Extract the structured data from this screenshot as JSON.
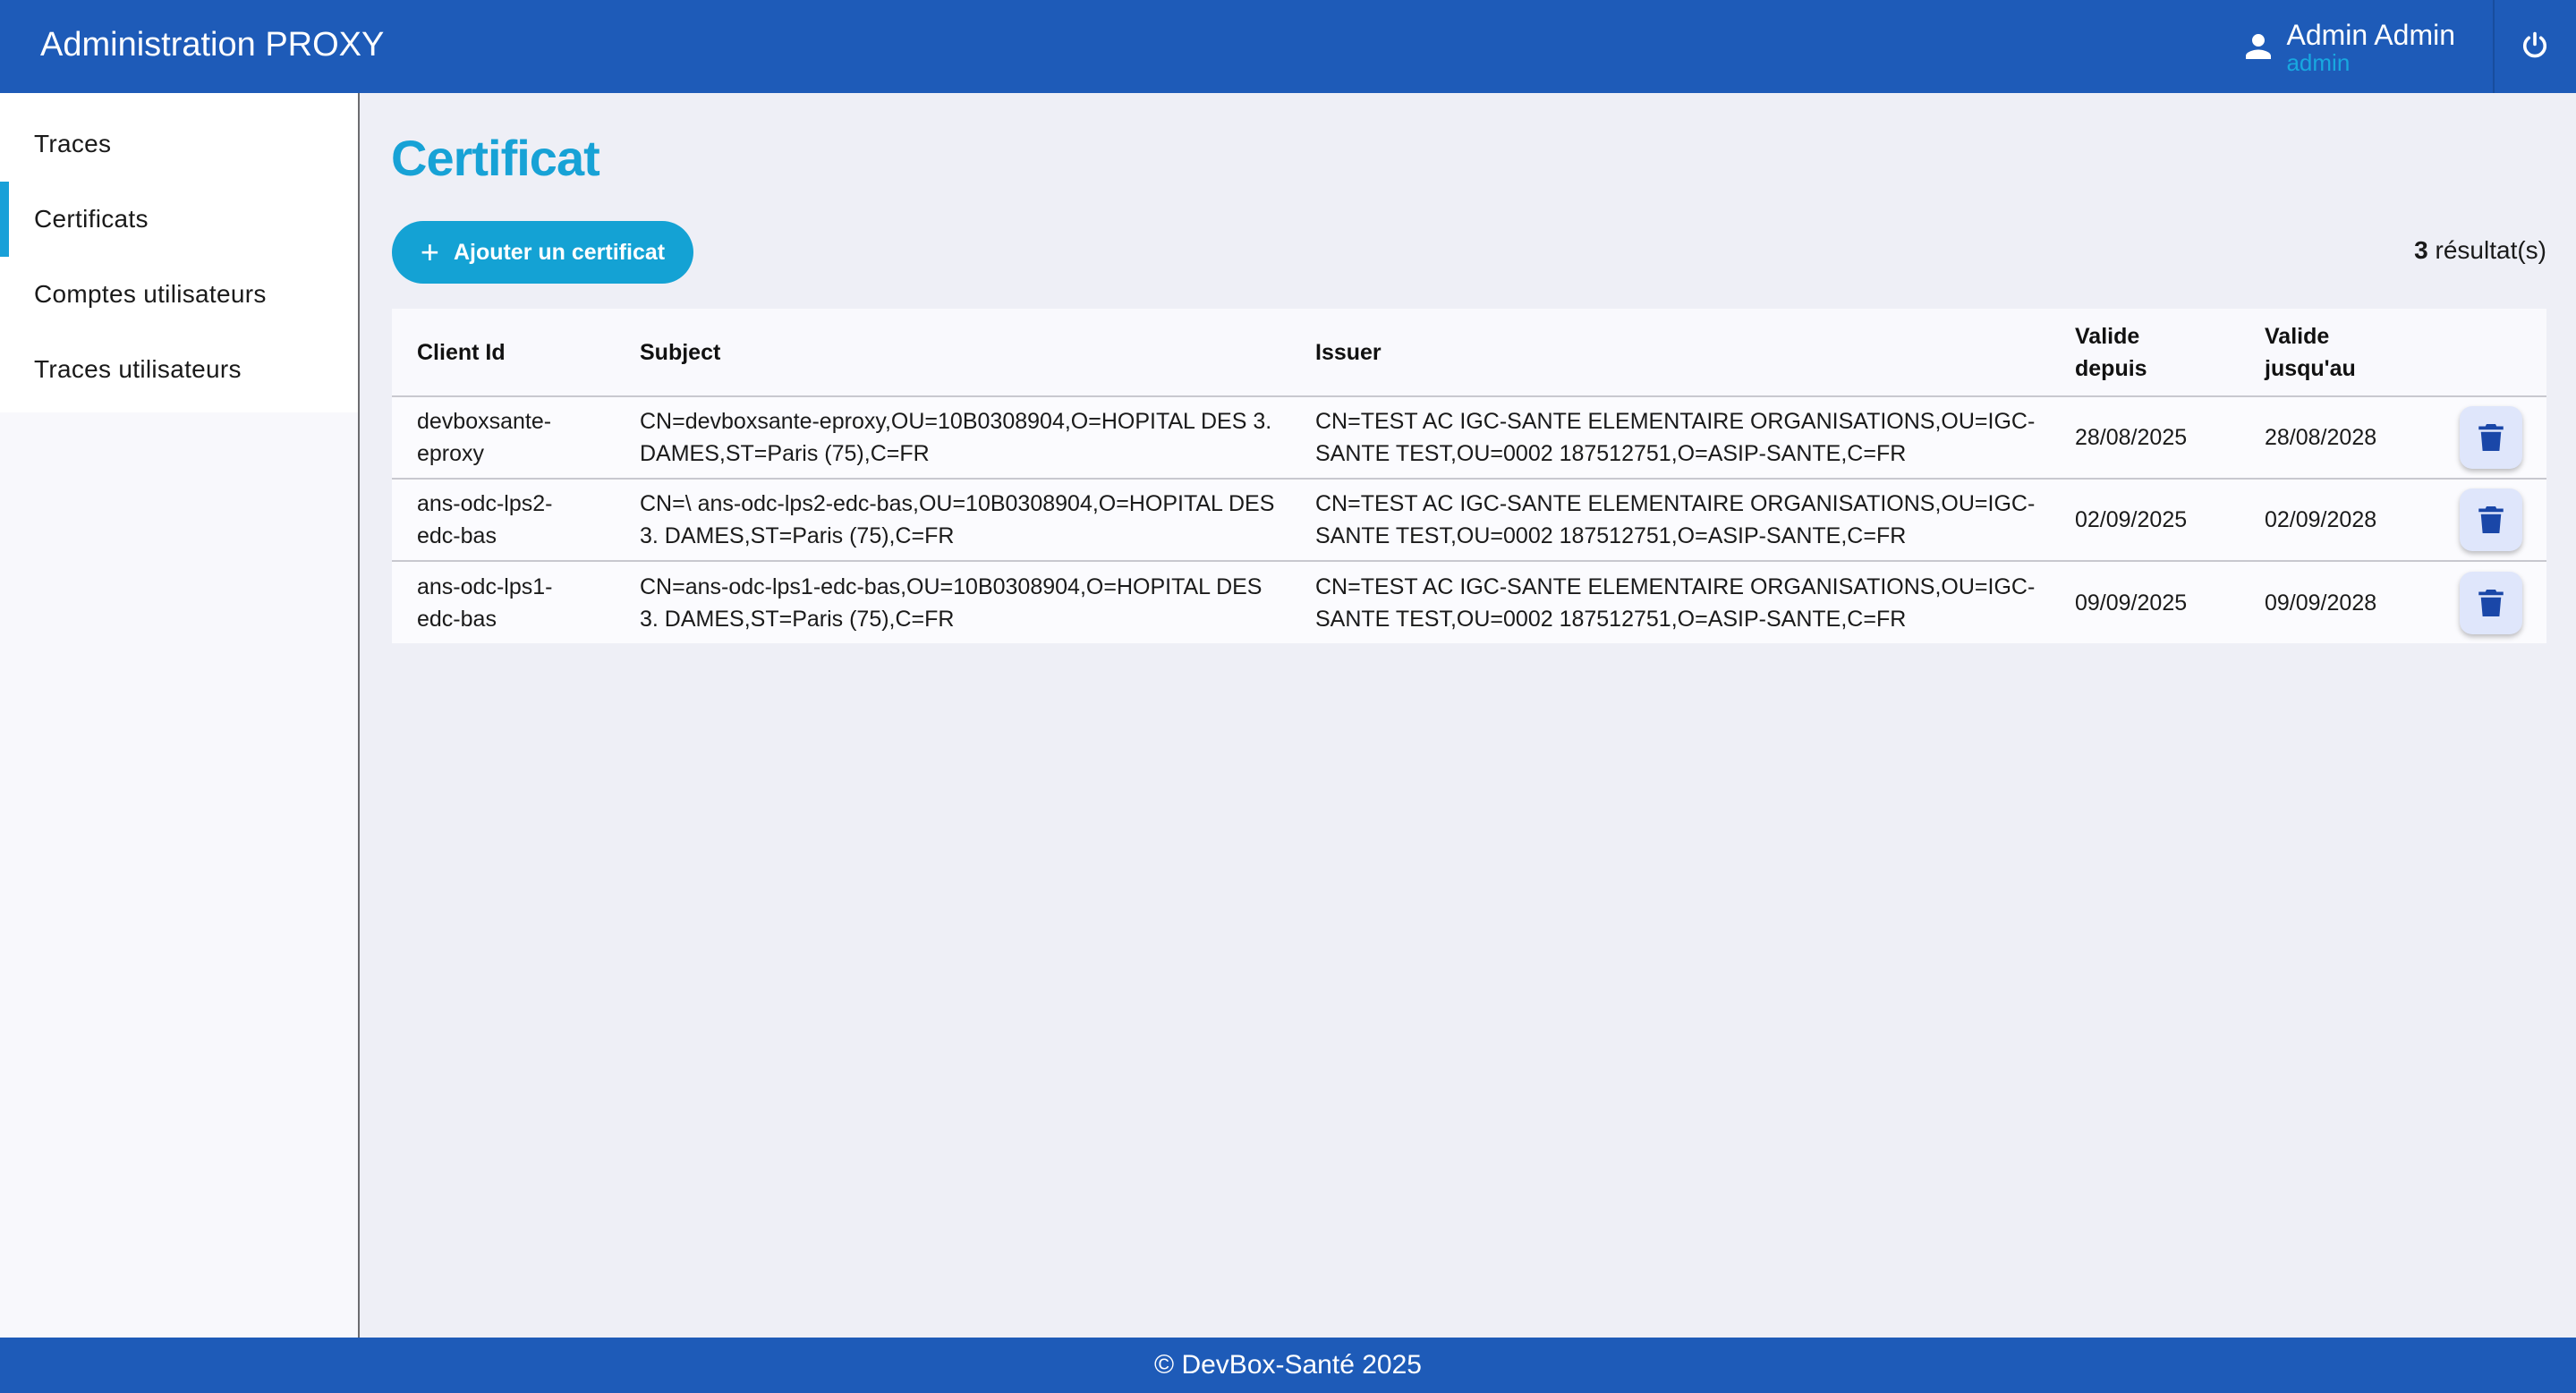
{
  "header": {
    "title": "Administration PROXY",
    "user_name": "Admin Admin",
    "user_login": "admin",
    "user_icon": "person-icon",
    "logout_icon": "power-icon"
  },
  "sidebar": {
    "items": [
      {
        "label": "Traces",
        "active": false
      },
      {
        "label": "Certificats",
        "active": true
      },
      {
        "label": "Comptes utilisateurs",
        "active": false
      },
      {
        "label": "Traces utilisateurs",
        "active": false
      }
    ]
  },
  "main": {
    "title": "Certificat",
    "add_button_label": "Ajouter un certificat",
    "result_count": "3",
    "result_suffix": "résultat(s)"
  },
  "table": {
    "headers": {
      "client_id": "Client Id",
      "subject": "Subject",
      "issuer": "Issuer",
      "valid_from_line1": "Valide",
      "valid_from_line2": "depuis",
      "valid_to_line1": "Valide",
      "valid_to_line2": "jusqu'au"
    },
    "rows": [
      {
        "client_id_1": "devboxsante-",
        "client_id_2": "eproxy",
        "subject_1": "CN=devboxsante-eproxy,OU=10B0308904,O=HOPITAL DES 3.",
        "subject_2": "DAMES,ST=Paris (75),C=FR",
        "issuer_1": "CN=TEST AC IGC-SANTE ELEMENTAIRE ORGANISATIONS,OU=IGC-",
        "issuer_2": "SANTE TEST,OU=0002 187512751,O=ASIP-SANTE,C=FR",
        "valid_from": "28/08/2025",
        "valid_to": "28/08/2028"
      },
      {
        "client_id_1": "ans-odc-lps2-",
        "client_id_2": "edc-bas",
        "subject_1": "CN=\\ ans-odc-lps2-edc-bas,OU=10B0308904,O=HOPITAL DES",
        "subject_2": "3. DAMES,ST=Paris (75),C=FR",
        "issuer_1": "CN=TEST AC IGC-SANTE ELEMENTAIRE ORGANISATIONS,OU=IGC-",
        "issuer_2": "SANTE TEST,OU=0002 187512751,O=ASIP-SANTE,C=FR",
        "valid_from": "02/09/2025",
        "valid_to": "02/09/2028"
      },
      {
        "client_id_1": "ans-odc-lps1-",
        "client_id_2": "edc-bas",
        "subject_1": "CN=ans-odc-lps1-edc-bas,OU=10B0308904,O=HOPITAL DES",
        "subject_2": "3. DAMES,ST=Paris (75),C=FR",
        "issuer_1": "CN=TEST AC IGC-SANTE ELEMENTAIRE ORGANISATIONS,OU=IGC-",
        "issuer_2": "SANTE TEST,OU=0002 187512751,O=ASIP-SANTE,C=FR",
        "valid_from": "09/09/2025",
        "valid_to": "09/09/2028"
      }
    ],
    "delete_icon": "trash-icon"
  },
  "footer": {
    "text": "© DevBox-Santé 2025"
  },
  "colors": {
    "header_bg": "#1e5bb8",
    "accent": "#17a2d6",
    "delete_icon": "#1a47a8"
  }
}
